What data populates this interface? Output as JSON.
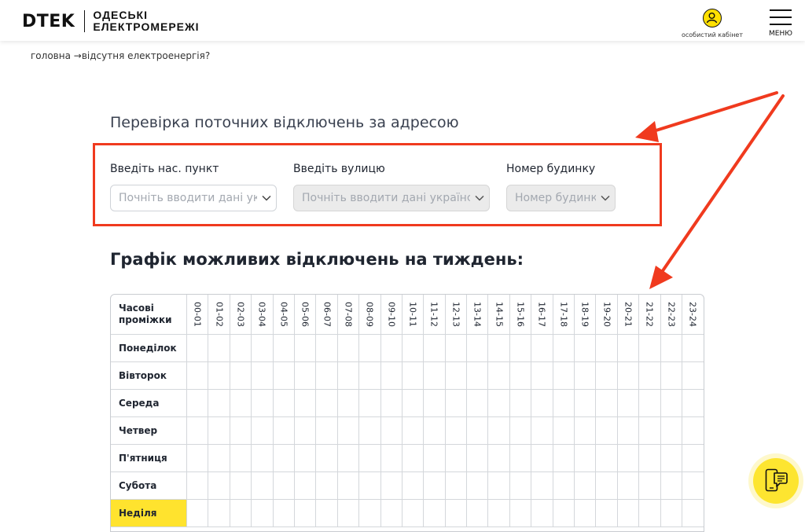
{
  "header": {
    "logo_mark": "DTEK",
    "logo_line1": "ОДЕСЬКІ",
    "logo_line2": "ЕЛЕКТРОМЕРЕЖІ",
    "cabinet_label": "особистий кабінет",
    "menu_label": "МЕНЮ"
  },
  "breadcrumb": {
    "home": "головна",
    "separator": "→",
    "current": "відсутня електроенергія?"
  },
  "address_check": {
    "title": "Перевірка поточних відключень за адресою",
    "city_label": "Введіть нас. пункт",
    "city_placeholder": "Почніть вводити дані українською",
    "street_label": "Введіть вулицю",
    "street_placeholder": "Почніть вводити дані українською",
    "house_label": "Номер будинку",
    "house_placeholder": "Номер будинку"
  },
  "schedule": {
    "title": "Графік можливих відключень на тиждень:",
    "corner_line1": "Часові",
    "corner_line2": "проміжки",
    "hours": [
      "00-01",
      "01-02",
      "02-03",
      "03-04",
      "04-05",
      "05-06",
      "06-07",
      "07-08",
      "08-09",
      "09-10",
      "10-11",
      "11-12",
      "12-13",
      "13-14",
      "14-15",
      "15-16",
      "16-17",
      "17-18",
      "18-19",
      "19-20",
      "20-21",
      "21-22",
      "22-23",
      "23-24"
    ],
    "days": [
      "Понеділок",
      "Вівторок",
      "Середа",
      "Четвер",
      "П'ятниця",
      "Субота",
      "Неділя"
    ],
    "highlighted_day": "Неділя"
  },
  "colors": {
    "brand_yellow": "#ffe32e",
    "annotation_red": "#f03a1e"
  },
  "icons": {
    "chevron": "chevron-down-icon",
    "user": "user-icon",
    "chat": "chat-phone-icon"
  }
}
